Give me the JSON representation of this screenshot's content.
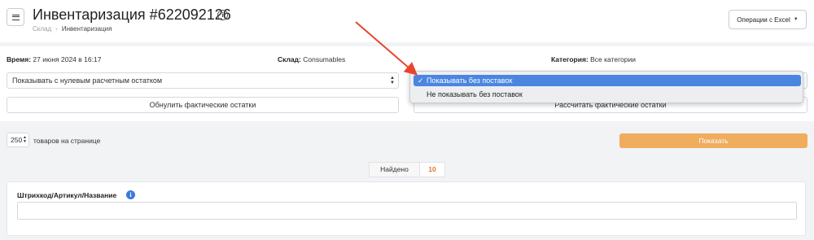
{
  "header": {
    "title": "Инвентаризация #622092126",
    "breadcrumb": [
      "Склад",
      "Инвентаризация"
    ],
    "excel_button": "Операции с Excel"
  },
  "params": {
    "time_label": "Время:",
    "time_value": "27 июня 2024 в 16:17",
    "warehouse_label": "Склад:",
    "warehouse_value": "Consumables",
    "category_label": "Категория:",
    "category_value": "Все категории",
    "zero_balance_select": "Показывать с нулевым расчетным остатком",
    "reset_button": "Обнулить фактические остатки",
    "calculate_button": "Рассчитать фактические остатки"
  },
  "supply_dropdown": {
    "options": [
      "Показывать без поставок",
      "Не показывать без поставок"
    ],
    "selected_index": 0,
    "check_mark": "✓"
  },
  "pagination": {
    "per_page_value": "250",
    "per_page_label": "товаров на странице",
    "show_button": "Показать"
  },
  "results": {
    "found_label": "Найдено",
    "found_count": "10"
  },
  "filter": {
    "label": "Штрихкод/Артикул/Название",
    "input_value": ""
  },
  "colors": {
    "accent": "#f0ad5e",
    "count": "#e2772e",
    "selection": "#4a86e0",
    "info": "#3b7bd9",
    "annotation_arrow": "#e8452c"
  }
}
